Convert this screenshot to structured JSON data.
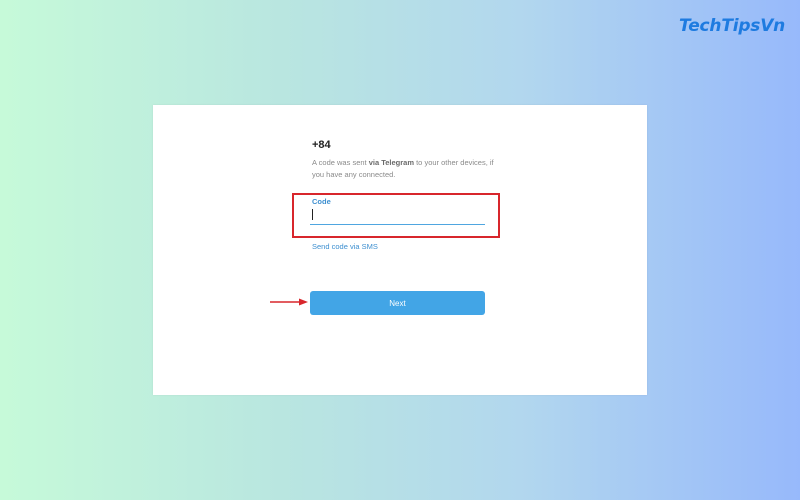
{
  "brand": {
    "logo_text": "TechTipsVn"
  },
  "login": {
    "phone": "+84",
    "info_prefix": "A code was sent ",
    "info_bold": "via Telegram",
    "info_suffix": " to your other devices, if you have any connected.",
    "code_label": "Code",
    "code_value": "",
    "sms_link": "Send code via SMS",
    "next_button": "Next"
  },
  "colors": {
    "accent": "#42a5e6",
    "link": "#3d8fd0",
    "annotation": "#d8262c"
  },
  "annotations": {
    "highlight_box": "red-rectangle",
    "pointer": "red-arrow-icon"
  }
}
